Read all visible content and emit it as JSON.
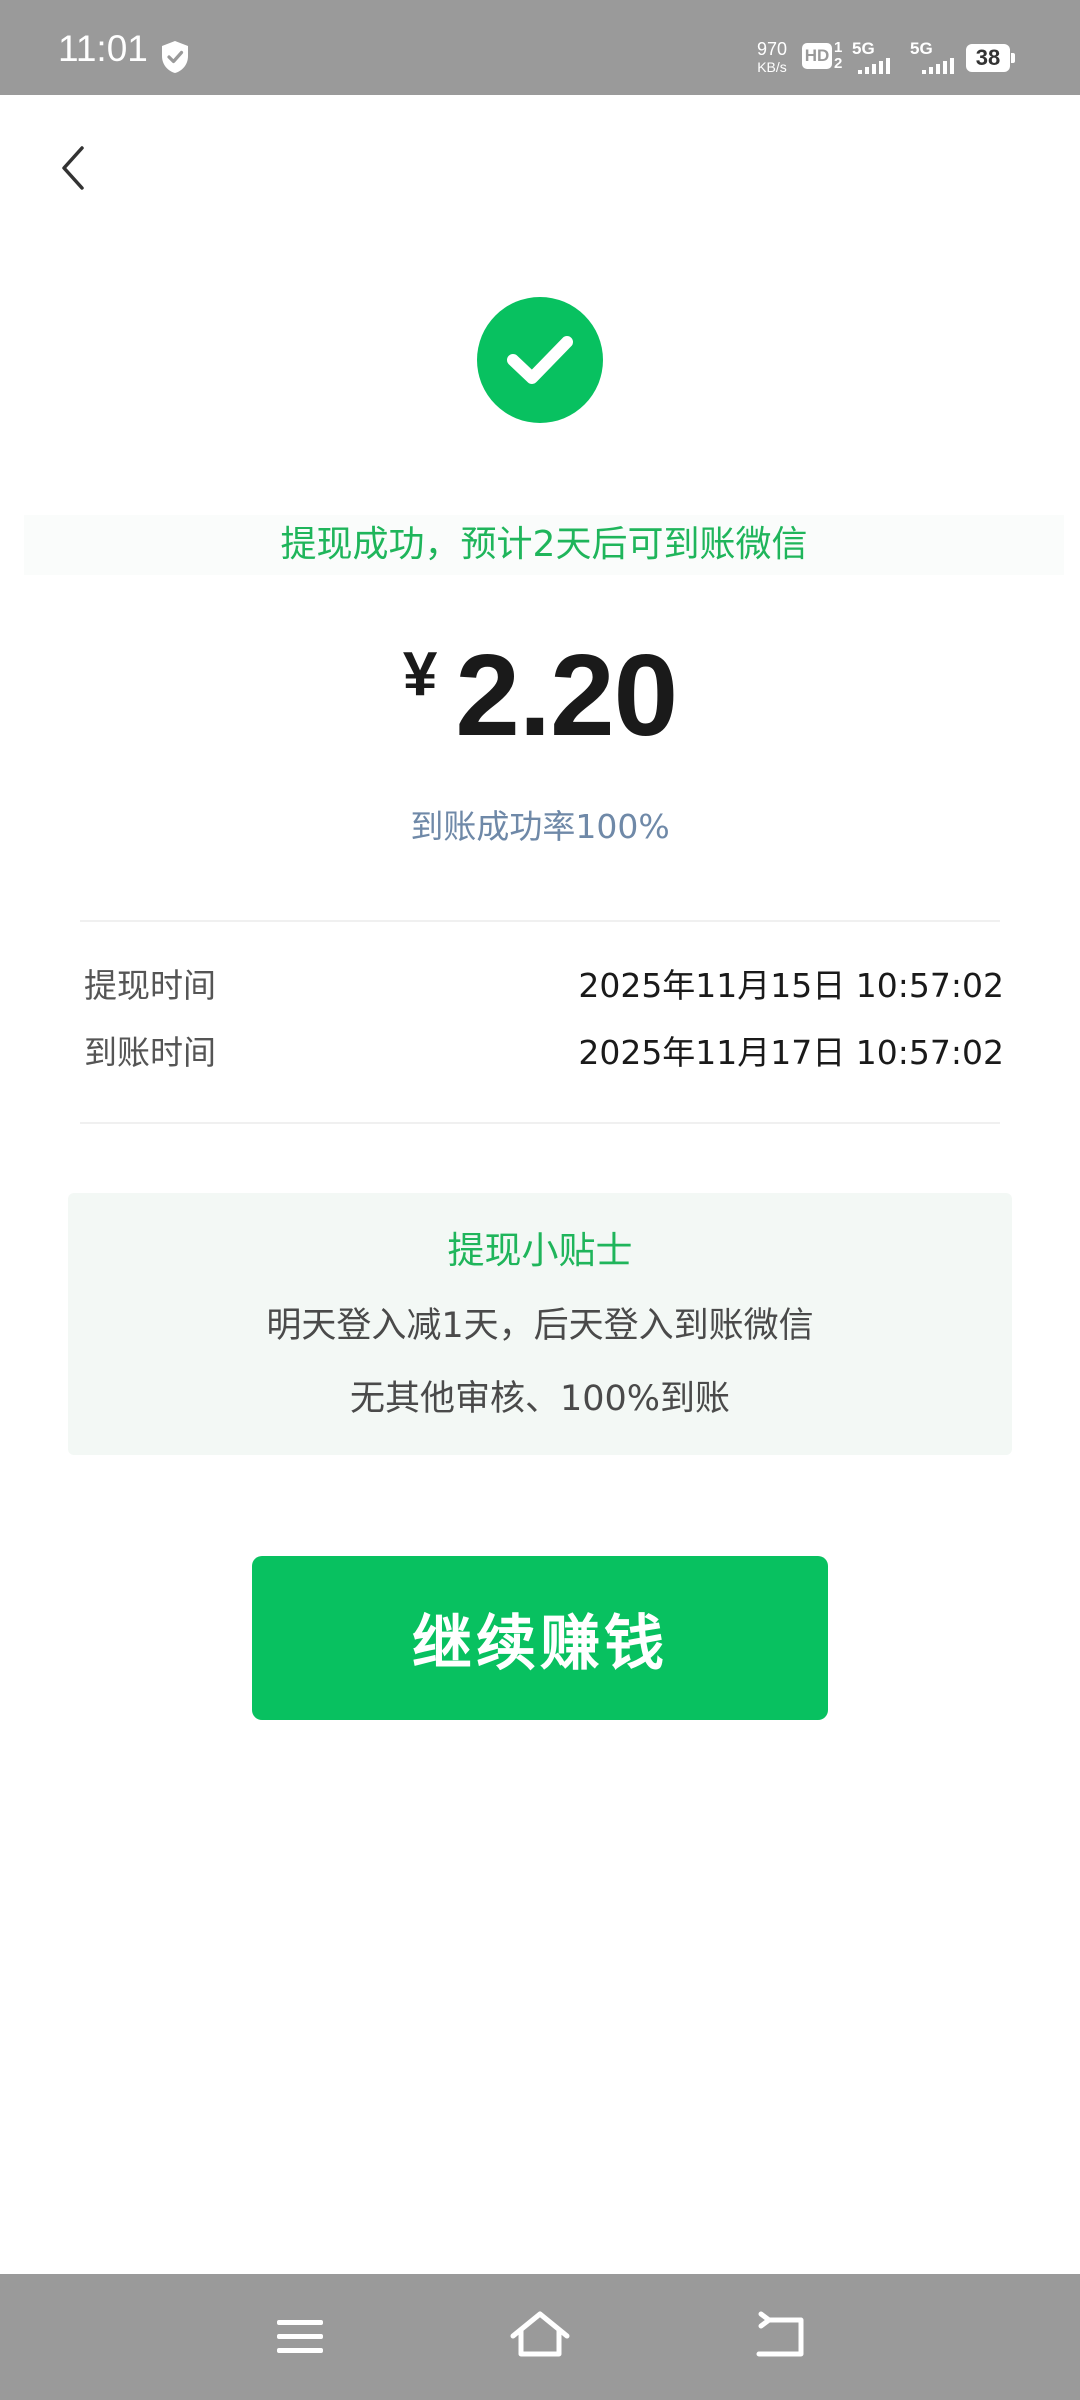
{
  "status_bar": {
    "time": "11:01",
    "net_speed_value": "970",
    "net_speed_unit": "KB/s",
    "hd_label": "HD",
    "sim_numbers": [
      "1",
      "2"
    ],
    "signal_labels": [
      "5G",
      "5G"
    ],
    "battery": "38",
    "icons": [
      "shield-icon",
      "signal-icon",
      "battery-icon"
    ]
  },
  "header": {
    "back_icon": "chevron-left-icon"
  },
  "result": {
    "status_icon": "check-circle-icon",
    "message": "提现成功，预计2天后可到账微信",
    "currency": "¥",
    "amount": "2.20",
    "success_rate": "到账成功率100%"
  },
  "details": [
    {
      "label": "提现时间",
      "value": "2025年11月15日 10:57:02"
    },
    {
      "label": "到账时间",
      "value": "2025年11月17日 10:57:02"
    }
  ],
  "tips": {
    "title": "提现小贴士",
    "lines": [
      "明天登入减1天，后天登入到账微信",
      "无其他审核、100%到账"
    ]
  },
  "actions": {
    "continue_label": "继续赚钱"
  },
  "nav_bar": {
    "icons": [
      "menu-icon",
      "home-icon",
      "back-icon"
    ]
  },
  "colors": {
    "accent_green": "#08c160",
    "message_green": "#1fb55b",
    "rate_blue": "#6f89a8",
    "tips_background": "#f3f8f5",
    "system_bar_gray": "#9a9a9a"
  }
}
